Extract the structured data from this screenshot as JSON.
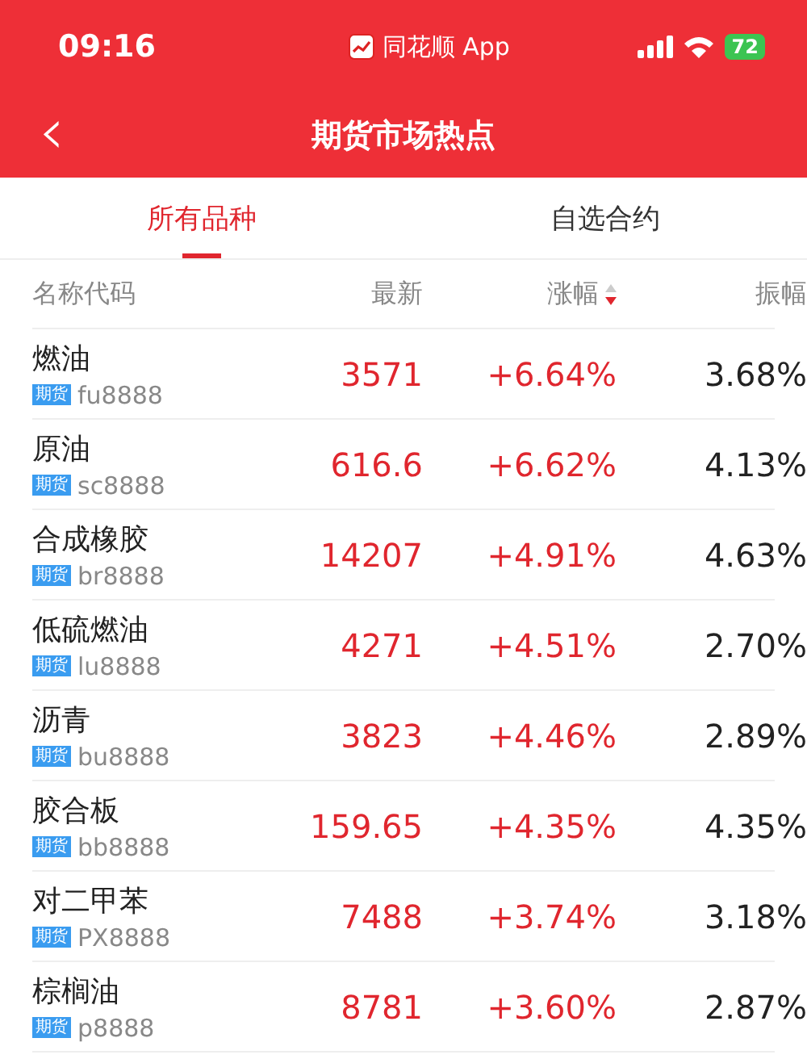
{
  "status_bar": {
    "time": "09:16",
    "app_name": "同花顺 App",
    "battery": "72"
  },
  "nav": {
    "back": "‹",
    "title": "期货市场热点"
  },
  "tabs": [
    {
      "label": "所有品种",
      "selected": true
    },
    {
      "label": "自选合约",
      "selected": false
    }
  ],
  "table": {
    "columns": [
      {
        "label": "名称代码",
        "sorted": false
      },
      {
        "label": "最新",
        "sorted": false
      },
      {
        "label": "涨幅",
        "sorted": true
      },
      {
        "label": "振幅",
        "sorted": false
      }
    ],
    "rows": [
      {
        "name": "燃油",
        "tag": "期货",
        "code": "fu8888",
        "latest": "3571",
        "change": "+6.64%",
        "amplitude": "3.68%"
      },
      {
        "name": "原油",
        "tag": "期货",
        "code": "sc8888",
        "latest": "616.6",
        "change": "+6.62%",
        "amplitude": "4.13%"
      },
      {
        "name": "合成橡胶",
        "tag": "期货",
        "code": "br8888",
        "latest": "14207",
        "change": "+4.91%",
        "amplitude": "4.63%"
      },
      {
        "name": "低硫燃油",
        "tag": "期货",
        "code": "lu8888",
        "latest": "4271",
        "change": "+4.51%",
        "amplitude": "2.70%"
      },
      {
        "name": "沥青",
        "tag": "期货",
        "code": "bu8888",
        "latest": "3823",
        "change": "+4.46%",
        "amplitude": "2.89%"
      },
      {
        "name": "胶合板",
        "tag": "期货",
        "code": "bb8888",
        "latest": "159.65",
        "change": "+4.35%",
        "amplitude": "4.35%"
      },
      {
        "name": "对二甲苯",
        "tag": "期货",
        "code": "PX8888",
        "latest": "7488",
        "change": "+3.74%",
        "amplitude": "3.18%"
      },
      {
        "name": "棕榈油",
        "tag": "期货",
        "code": "p8888",
        "latest": "8781",
        "change": "+3.60%",
        "amplitude": "2.87%"
      }
    ]
  }
}
